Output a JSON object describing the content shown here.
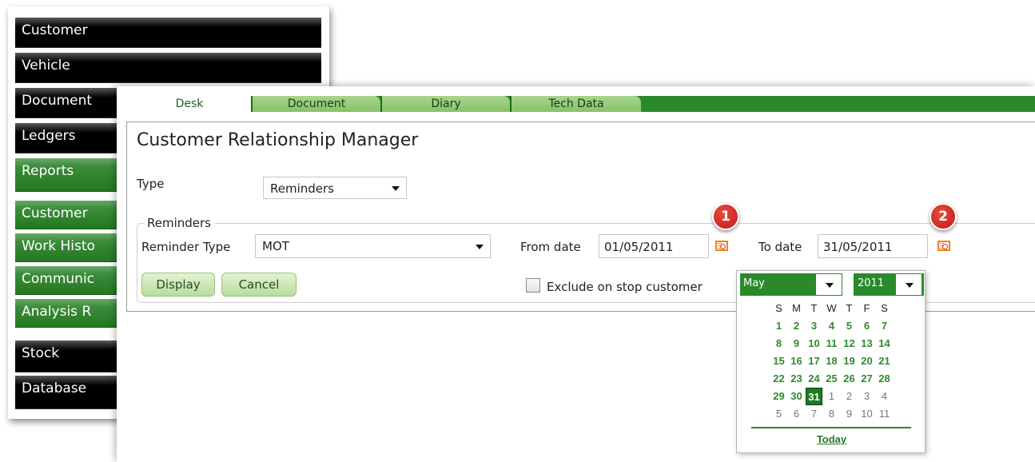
{
  "sidebar": {
    "items": [
      {
        "label": "Customer",
        "style": "dark"
      },
      {
        "label": "Vehicle",
        "style": "dark"
      },
      {
        "label": "Document",
        "style": "dark"
      },
      {
        "label": "Ledgers",
        "style": "dark"
      },
      {
        "label": "Reports",
        "style": "green"
      },
      {
        "label": "Customer",
        "style": "green"
      },
      {
        "label": "Work Histo",
        "style": "green"
      },
      {
        "label": "Communic",
        "style": "green"
      },
      {
        "label": "Analysis R",
        "style": "green"
      },
      {
        "label": "Stock",
        "style": "dark"
      },
      {
        "label": "Database",
        "style": "dark"
      }
    ]
  },
  "tabs": [
    {
      "label": "Desk",
      "active": true
    },
    {
      "label": "Document",
      "active": false
    },
    {
      "label": "Diary",
      "active": false
    },
    {
      "label": "Tech Data",
      "active": false
    }
  ],
  "crm": {
    "title": "Customer Relationship Manager",
    "type_label": "Type",
    "type_value": "Reminders",
    "group_legend": "Reminders",
    "reminder_type_label": "Reminder Type",
    "reminder_type_value": "MOT",
    "from_label": "From date",
    "from_value": "01/05/2011",
    "to_label": "To date",
    "to_value": "31/05/2011",
    "display_button": "Display",
    "cancel_button": "Cancel",
    "exclude_label": "Exclude on stop customer",
    "exclude_checked": false
  },
  "badges": {
    "first": "1",
    "second": "2"
  },
  "calendar": {
    "month": "May",
    "year": "2011",
    "weekday_headers": [
      "S",
      "M",
      "T",
      "W",
      "T",
      "F",
      "S"
    ],
    "weeks": [
      [
        "1",
        "2",
        "3",
        "4",
        "5",
        "6",
        "7"
      ],
      [
        "8",
        "9",
        "10",
        "11",
        "12",
        "13",
        "14"
      ],
      [
        "15",
        "16",
        "17",
        "18",
        "19",
        "20",
        "21"
      ],
      [
        "22",
        "23",
        "24",
        "25",
        "26",
        "27",
        "28"
      ],
      [
        "29",
        "30",
        "31",
        "1",
        "2",
        "3",
        "4"
      ],
      [
        "5",
        "6",
        "7",
        "8",
        "9",
        "10",
        "11"
      ]
    ],
    "selected_day": "31",
    "today_label": "Today"
  },
  "colors": {
    "accent_green": "#2a8a2a",
    "badge_red": "#d42a22",
    "calendar_icon_orange": "#f08020"
  }
}
